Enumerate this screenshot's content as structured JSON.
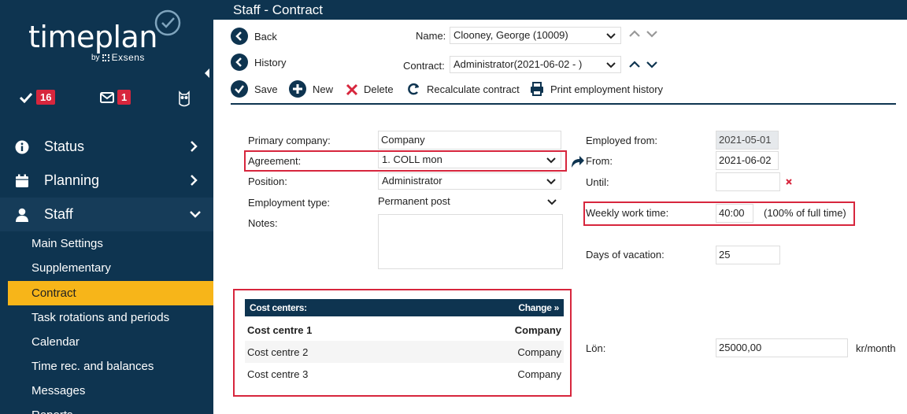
{
  "sidebar": {
    "logo_text": "timeplan",
    "logo_by": "by",
    "logo_brand": "Exsens",
    "tasks_count": "16",
    "messages_count": "1",
    "nav": [
      {
        "label": "Status"
      },
      {
        "label": "Planning"
      },
      {
        "label": "Staff"
      }
    ],
    "staff_items": [
      "Main Settings",
      "Supplementary",
      "Contract",
      "Task rotations and periods",
      "Calendar",
      "Time rec. and balances",
      "Messages",
      "Reports"
    ]
  },
  "header": {
    "title": "Staff - Contract"
  },
  "toolbar": {
    "back": "Back",
    "history": "History",
    "save": "Save",
    "new": "New",
    "delete": "Delete",
    "recalculate": "Recalculate contract",
    "print": "Print employment history",
    "name_label": "Name:",
    "name_value": "Clooney, George (10009)",
    "contract_label": "Contract:",
    "contract_value": "Administrator(2021-06-02 - )"
  },
  "form": {
    "primary_company_label": "Primary company:",
    "primary_company_value": "Company",
    "agreement_label": "Agreement:",
    "agreement_value": "1. COLL mon",
    "position_label": "Position:",
    "position_value": "Administrator",
    "employment_type_label": "Employment type:",
    "employment_type_value": "Permanent post",
    "notes_label": "Notes:",
    "employed_from_label": "Employed from:",
    "employed_from_value": "2021-05-01",
    "from_label": "From:",
    "from_value": "2021-06-02",
    "until_label": "Until:",
    "until_value": "",
    "weekly_label": "Weekly work time:",
    "weekly_value": "40:00",
    "weekly_pct": "(100% of full time)",
    "vacation_label": "Days of vacation:",
    "vacation_value": "25",
    "salary_label": "Lön:",
    "salary_value": "25000,00",
    "salary_unit": "kr/month"
  },
  "cost_centers": {
    "header": "Cost centers:",
    "change": "Change »",
    "rows": [
      {
        "name": "Cost centre 1",
        "company": "Company"
      },
      {
        "name": "Cost centre 2",
        "company": "Company"
      },
      {
        "name": "Cost centre 3",
        "company": "Company"
      }
    ]
  },
  "colors": {
    "navy": "#0e3450",
    "accent_yellow": "#f7b519",
    "highlight_red": "#d7263d"
  }
}
